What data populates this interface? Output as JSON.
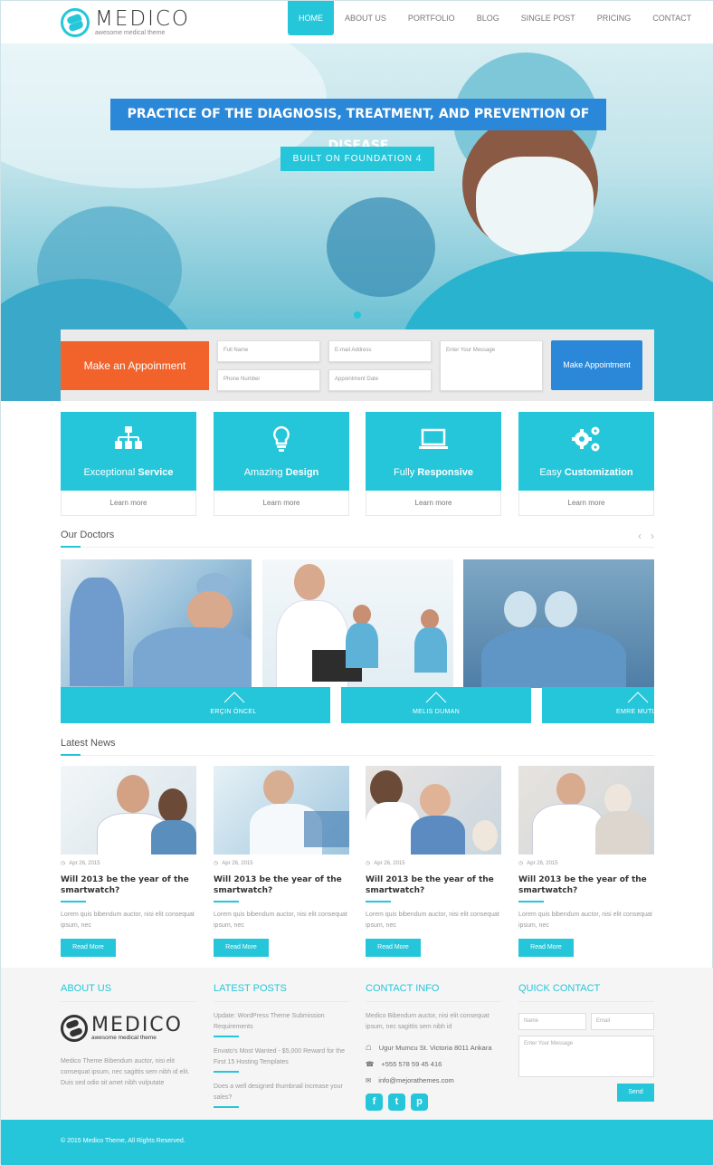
{
  "brand": {
    "name": "MEDICO",
    "tagline": "awesome medical theme"
  },
  "nav": [
    "HOME",
    "ABOUT US",
    "PORTFOLIO",
    "BLOG",
    "SINGLE POST",
    "PRICING",
    "CONTACT"
  ],
  "nav_active": "HOME",
  "hero": {
    "title": "PRACTICE OF THE DIAGNOSIS, TREATMENT, AND PREVENTION OF DISEASE",
    "subtitle": "BUILT ON FOUNDATION 4"
  },
  "appointment": {
    "label": "Make an Appoinment",
    "fields": {
      "full_name": "Full Name",
      "email": "E-mail Address",
      "phone": "Phone Number",
      "date": "Appointment Date",
      "message": "Enter Your Message"
    },
    "button": "Make Appointment"
  },
  "features": [
    {
      "light": "Exceptional ",
      "bold": "Service",
      "icon": "sitemap-icon",
      "link": "Learn more"
    },
    {
      "light": "Amazing ",
      "bold": "Design",
      "icon": "lightbulb-icon",
      "link": "Learn more"
    },
    {
      "light": "Fully ",
      "bold": "Responsive",
      "icon": "laptop-icon",
      "link": "Learn more"
    },
    {
      "light": "Easy ",
      "bold": "Customization",
      "icon": "gears-icon",
      "link": "Learn more"
    }
  ],
  "doctors": {
    "title": "Our Doctors",
    "names": [
      "ERÇIN ÖNCEL",
      "MELIS DUMAN",
      "EMRE MUTL"
    ]
  },
  "news": {
    "title": "Latest News",
    "items": [
      {
        "date": "Apr 26, 2015",
        "title": "Will 2013 be the year of the smartwatch?",
        "text": "Lorem quis bibendum auctor, nisi elit consequat ipsum, nec",
        "button": "Read More"
      },
      {
        "date": "Apr 26, 2015",
        "title": "Will 2013 be the year of the smartwatch?",
        "text": "Lorem quis bibendum auctor, nisi elit consequat ipsum, nec",
        "button": "Read More"
      },
      {
        "date": "Apr 26, 2015",
        "title": "Will 2013 be the year of the smartwatch?",
        "text": "Lorem quis bibendum auctor, nisi elit consequat ipsum, nec",
        "button": "Read More"
      },
      {
        "date": "Apr 26, 2015",
        "title": "Will 2013 be the year of the smartwatch?",
        "text": "Lorem quis bibendum auctor, nisi elit consequat ipsum, nec",
        "button": "Read More"
      }
    ]
  },
  "footer": {
    "about": {
      "heading": "ABOUT US",
      "text": "Medico Theme Bibendum auctor, nisi elit consequat ipsum, nec sagittis sem nibh id elit. Duis sed odio sit amet nibh vulputate"
    },
    "posts": {
      "heading": "LATEST POSTS",
      "items": [
        "Update: WordPress Theme Submission Requirements",
        "Envato's Most Wanted - $5,000 Reward for the First 15 Hosting Templates",
        "Does a well designed thumbnail increase your sales?"
      ]
    },
    "contact": {
      "heading": "CONTACT INFO",
      "text": "Medico Bibendum auctor, nisi elit consequat ipsum, nec sagittis sem nibh id",
      "address": "Ugur Mumcu St. Victoria 8011 Ankara",
      "phone": "+555 578 59 45 416",
      "email": "info@mejorathemes.com",
      "social": [
        "f",
        "t",
        "p"
      ]
    },
    "quick": {
      "heading": "QUICK CONTACT",
      "name": "Name",
      "email": "Email",
      "message": "Enter Your Message",
      "send": "Send"
    },
    "copyright": "© 2015 Medico Theme, All Rights Reserved."
  }
}
